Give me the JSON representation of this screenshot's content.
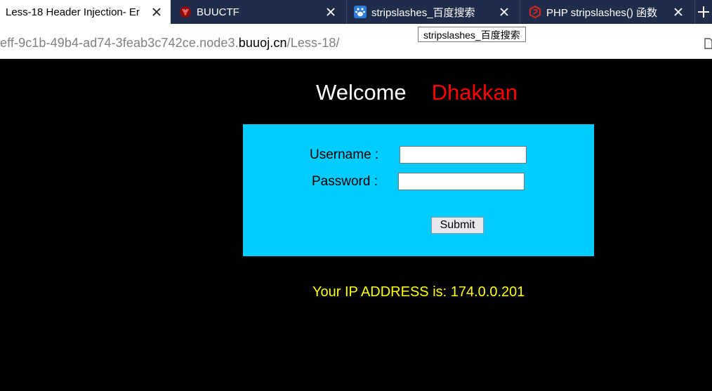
{
  "browser": {
    "tabs": [
      {
        "title": "Less-18 Header Injection- Er",
        "icon": "page-icon",
        "active": true
      },
      {
        "title": "BUUCTF",
        "icon": "buuctf-logo-icon",
        "active": false
      },
      {
        "title": "stripslashes_百度搜索",
        "icon": "baidu-paw-icon",
        "active": false
      },
      {
        "title": "PHP stripslashes() 函数",
        "icon": "runoob-logo-icon",
        "active": false
      }
    ],
    "url_prefix": "eff-9c1b-49b4-ad74-3feab3c742ce.node3.",
    "url_domain": "buuoj.cn",
    "url_path": "/Less-18/",
    "tooltip": "stripslashes_百度搜索",
    "colors": {
      "tab_bar": "#202d4a",
      "active_tab": "#ffffff"
    }
  },
  "page": {
    "welcome": "Welcome",
    "name": "Dhakkan",
    "username_label": "Username :",
    "password_label": "Password :",
    "username_value": "",
    "password_value": "",
    "submit_label": "Submit",
    "ip_text": "Your IP ADDRESS is: 174.0.0.201",
    "colors": {
      "background": "#000000",
      "welcome": "#ffffff",
      "name": "#ff0000",
      "form_box": "#00ccff",
      "ip_text": "#ffff00"
    }
  }
}
